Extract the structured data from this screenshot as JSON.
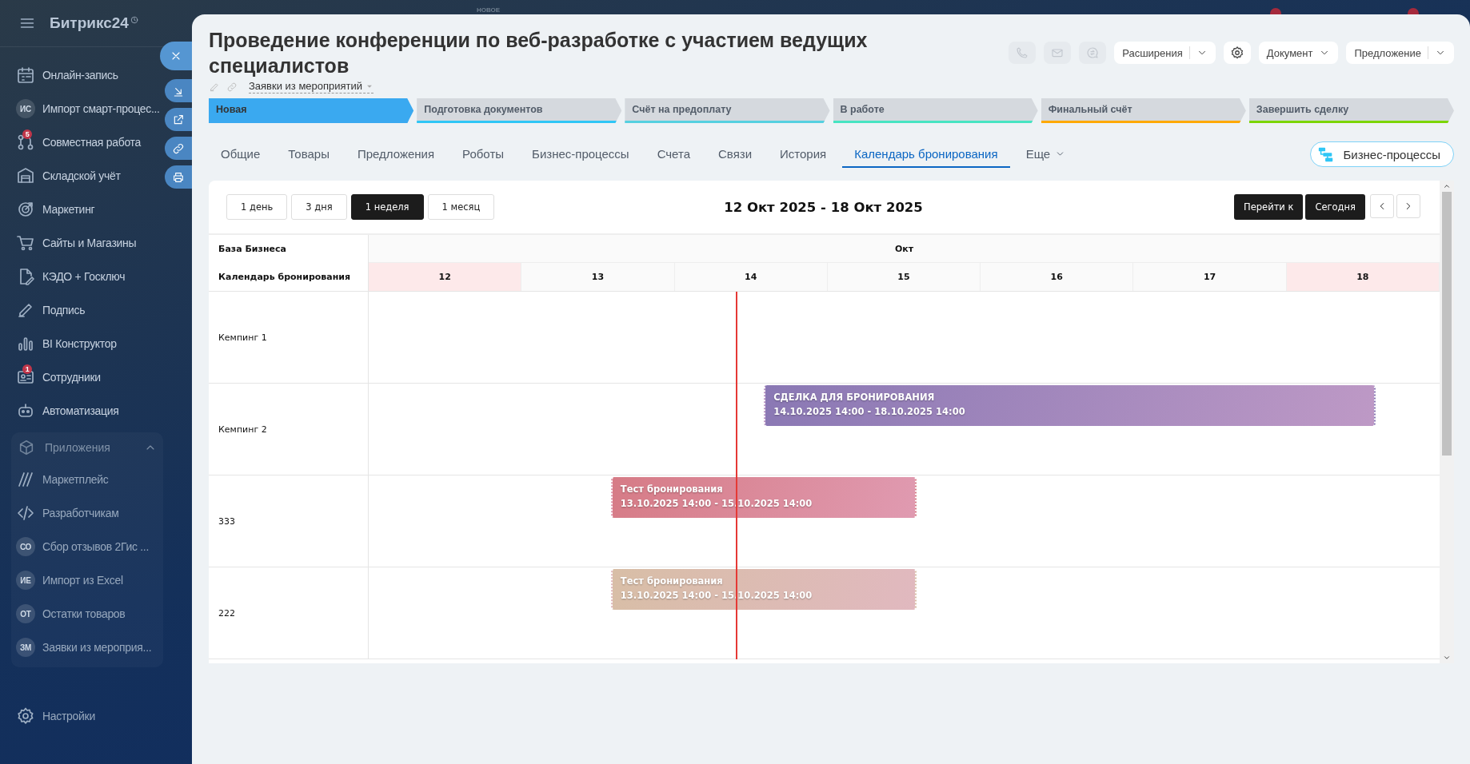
{
  "sidebar": {
    "logo": "Битрикс24",
    "items": [
      {
        "label": "Онлайн-запись",
        "kind": "icon"
      },
      {
        "label": "Импорт смарт-процес...",
        "kind": "initials",
        "initials": "ИС"
      },
      {
        "label": "Совместная работа",
        "kind": "icon",
        "badge": "5"
      },
      {
        "label": "Складской учёт",
        "kind": "icon"
      },
      {
        "label": "Маркетинг",
        "kind": "icon"
      },
      {
        "label": "Сайты и Магазины",
        "kind": "icon"
      },
      {
        "label": "КЭДО + Госключ",
        "kind": "icon"
      },
      {
        "label": "Подпись",
        "kind": "icon"
      },
      {
        "label": "BI Конструктор",
        "kind": "icon"
      },
      {
        "label": "Сотрудники",
        "kind": "icon",
        "badge": "1"
      },
      {
        "label": "Автоматизация",
        "kind": "icon"
      }
    ],
    "section": {
      "label": "Приложения",
      "expanded": true,
      "items": [
        {
          "label": "Маркетплейс",
          "kind": "icon"
        },
        {
          "label": "Разработчикам",
          "kind": "icon"
        },
        {
          "label": "Сбор отзывов 2Гис ...",
          "kind": "initials",
          "initials": "СО"
        },
        {
          "label": "Импорт из Excel",
          "kind": "initials",
          "initials": "ИЕ"
        },
        {
          "label": "Остатки товаров",
          "kind": "initials",
          "initials": "ОТ"
        },
        {
          "label": "Заявки из мероприя...",
          "kind": "initials",
          "initials": "ЗМ"
        }
      ]
    },
    "settings": "Настройки"
  },
  "topbar": {
    "label": "НОВОЕ"
  },
  "deal": {
    "title": "Проведение конференции по веб-разработке с участием ведущих специалистов",
    "category": "Заявки из мероприятий",
    "actions": [
      {
        "label": "Расширения",
        "kind": "split"
      },
      {
        "label": "Документ",
        "kind": "dropdown"
      },
      {
        "label": "Предложение",
        "kind": "split"
      }
    ]
  },
  "stages": [
    {
      "label": "Новая",
      "color": "#3aa9f0",
      "selected": true
    },
    {
      "label": "Подготовка документов",
      "color": "#2fc6f6",
      "selected": false
    },
    {
      "label": "Счёт на предоплату",
      "color": "#55d0e0",
      "selected": false
    },
    {
      "label": "В работе",
      "color": "#47e4c2",
      "selected": false
    },
    {
      "label": "Финальный счёт",
      "color": "#ffa900",
      "selected": false
    },
    {
      "label": "Завершить сделку",
      "color": "#7bd500",
      "selected": false
    }
  ],
  "tabs": [
    {
      "label": "Общие",
      "selected": false
    },
    {
      "label": "Товары",
      "selected": false
    },
    {
      "label": "Предложения",
      "selected": false
    },
    {
      "label": "Роботы",
      "selected": false
    },
    {
      "label": "Бизнес-процессы",
      "selected": false
    },
    {
      "label": "Счета",
      "selected": false
    },
    {
      "label": "Связи",
      "selected": false
    },
    {
      "label": "История",
      "selected": false
    },
    {
      "label": "Календарь бронирования",
      "selected": true
    },
    {
      "label": "Еще",
      "selected": false
    }
  ],
  "bp_button": "Бизнес-процессы",
  "calendar": {
    "views": [
      {
        "label": "1 день",
        "selected": false
      },
      {
        "label": "3 дня",
        "selected": false
      },
      {
        "label": "1 неделя",
        "selected": true
      },
      {
        "label": "1 месяц",
        "selected": false
      }
    ],
    "range": "12 Окт 2025 - 18 Окт 2025",
    "goto": "Перейти к",
    "today": "Сегодня",
    "corner_top": "База Бизнеса",
    "corner_bottom": "Календарь бронирования",
    "month": "Окт",
    "days": [
      {
        "label": "12",
        "weekend": true
      },
      {
        "label": "13",
        "weekend": false
      },
      {
        "label": "14",
        "weekend": false
      },
      {
        "label": "15",
        "weekend": false
      },
      {
        "label": "16",
        "weekend": false
      },
      {
        "label": "17",
        "weekend": false
      },
      {
        "label": "18",
        "weekend": true
      }
    ],
    "rows": [
      {
        "name": "Кемпинг 1",
        "events": []
      },
      {
        "name": "Кемпинг 2",
        "events": [
          {
            "title": "СДЕЛКА ДЛЯ БРОНИРОВАНИЯ",
            "period": "14.10.2025 14:00 - 18.10.2025 14:00",
            "color": "#8a78b4"
          }
        ]
      },
      {
        "name": "333",
        "events": [
          {
            "title": "Тест бронирования",
            "period": "13.10.2025 14:00 - 15.10.2025 14:00",
            "color": "#d67b86"
          }
        ]
      },
      {
        "name": "222",
        "events": [
          {
            "title": "Тест бронирования",
            "period": "13.10.2025 14:00 - 15.10.2025 14:00",
            "color": "#d8bea6"
          }
        ]
      }
    ]
  }
}
